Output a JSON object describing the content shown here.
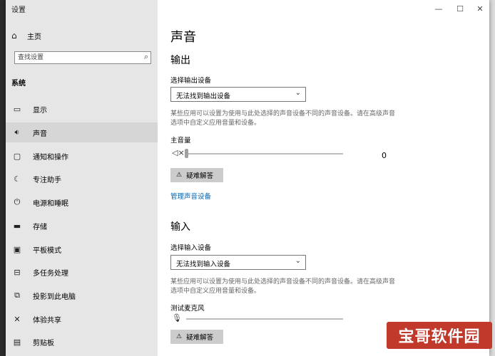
{
  "window": {
    "title": "设置",
    "minimize": "—",
    "maximize": "☐",
    "close": "✕"
  },
  "sidebar": {
    "home_label": "主页",
    "search_placeholder": "查找设置",
    "section_label": "系统",
    "items": [
      {
        "label": "显示",
        "icon": "display-icon"
      },
      {
        "label": "声音",
        "icon": "speaker-icon"
      },
      {
        "label": "通知和操作",
        "icon": "notification-icon"
      },
      {
        "label": "专注助手",
        "icon": "focus-assist-icon"
      },
      {
        "label": "电源和睡眠",
        "icon": "power-icon"
      },
      {
        "label": "存储",
        "icon": "storage-icon"
      },
      {
        "label": "平板模式",
        "icon": "tablet-icon"
      },
      {
        "label": "多任务处理",
        "icon": "multitask-icon"
      },
      {
        "label": "投影到此电脑",
        "icon": "project-icon"
      },
      {
        "label": "体验共享",
        "icon": "shared-experience-icon"
      },
      {
        "label": "剪贴板",
        "icon": "clipboard-icon"
      }
    ]
  },
  "main": {
    "title": "声音",
    "output": {
      "heading": "输出",
      "device_label": "选择输出设备",
      "device_value": "无法找到输出设备",
      "description": "某些应用可以设置为使用与此处选择的声音设备不同的声音设备。请在高级声音选项中自定义应用音量和设备。",
      "volume_label": "主音量",
      "volume_value": "0",
      "volume_level": 0,
      "troubleshoot_label": "疑难解答",
      "manage_link": "管理声音设备"
    },
    "input": {
      "heading": "输入",
      "device_label": "选择输入设备",
      "device_value": "无法找到输入设备",
      "description": "某些应用可以设置为使用与此处选择的声音设备不同的声音设备。请在高级声音选项中自定义应用音量和设备。",
      "mic_label": "测试麦克风",
      "troubleshoot_label": "疑难解答"
    }
  },
  "watermark": "宝哥软件园",
  "colors": {
    "link": "#0063b1",
    "sidebar_bg": "#e6e6e6",
    "button_bg": "#cccccc",
    "watermark_bg": "#c0392b"
  }
}
